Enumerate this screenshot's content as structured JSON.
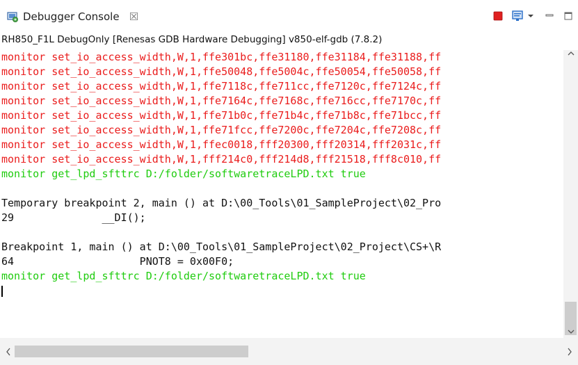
{
  "tab": {
    "title": "Debugger Console",
    "close_glyph": "☒",
    "icon": "debugger-console-icon"
  },
  "toolbar": {
    "stop_icon": "terminate-icon",
    "display_icon": "display-console-icon",
    "dropdown_icon": "chevron-down-icon",
    "minimize_icon": "minimize-icon",
    "maximize_icon": "maximize-icon",
    "stop_color": "#e02020",
    "display_color": "#2a6fc9"
  },
  "session_label": "RH850_F1L DebugOnly [Renesas GDB Hardware Debugging] v850-elf-gdb (7.8.2)",
  "console": {
    "lines": [
      {
        "text": "monitor set_io_access_width,W,1,ffe301bc,ffe31180,ffe31184,ffe31188,ff",
        "color": "red"
      },
      {
        "text": "monitor set_io_access_width,W,1,ffe50048,ffe5004c,ffe50054,ffe50058,ff",
        "color": "red"
      },
      {
        "text": "monitor set_io_access_width,W,1,ffe7118c,ffe711cc,ffe7120c,ffe7124c,ff",
        "color": "red"
      },
      {
        "text": "monitor set_io_access_width,W,1,ffe7164c,ffe7168c,ffe716cc,ffe7170c,ff",
        "color": "red"
      },
      {
        "text": "monitor set_io_access_width,W,1,ffe71b0c,ffe71b4c,ffe71b8c,ffe71bcc,ff",
        "color": "red"
      },
      {
        "text": "monitor set_io_access_width,W,1,ffe71fcc,ffe7200c,ffe7204c,ffe7208c,ff",
        "color": "red"
      },
      {
        "text": "monitor set_io_access_width,W,1,ffec0018,fff20300,fff20314,fff2031c,ff",
        "color": "red"
      },
      {
        "text": "monitor set_io_access_width,W,1,fff214c0,fff214d8,fff21518,fff8c010,ff",
        "color": "red"
      },
      {
        "text": "monitor get_lpd_sfttrc D:/folder/softwaretraceLPD.txt true",
        "color": "green"
      },
      {
        "text": "",
        "color": "black"
      },
      {
        "text": "Temporary breakpoint 2, main () at D:\\00_Tools\\01_SampleProject\\02_Pro",
        "color": "black"
      },
      {
        "text": "29              __DI();",
        "color": "black"
      },
      {
        "text": "",
        "color": "black"
      },
      {
        "text": "Breakpoint 1, main () at D:\\00_Tools\\01_SampleProject\\02_Project\\CS+\\R",
        "color": "black"
      },
      {
        "text": "64                    PNOT8 = 0x00F0;",
        "color": "black"
      },
      {
        "text": "monitor get_lpd_sfttrc D:/folder/softwaretraceLPD.txt true",
        "color": "green"
      }
    ]
  },
  "colors": {
    "error_text": "#ea1c1c",
    "input_text": "#1fcc0e",
    "output_text": "#111111"
  },
  "scrollbars": {
    "up_arrow": "^",
    "down_arrow": "v",
    "left_arrow": "<",
    "right_arrow": ">"
  }
}
